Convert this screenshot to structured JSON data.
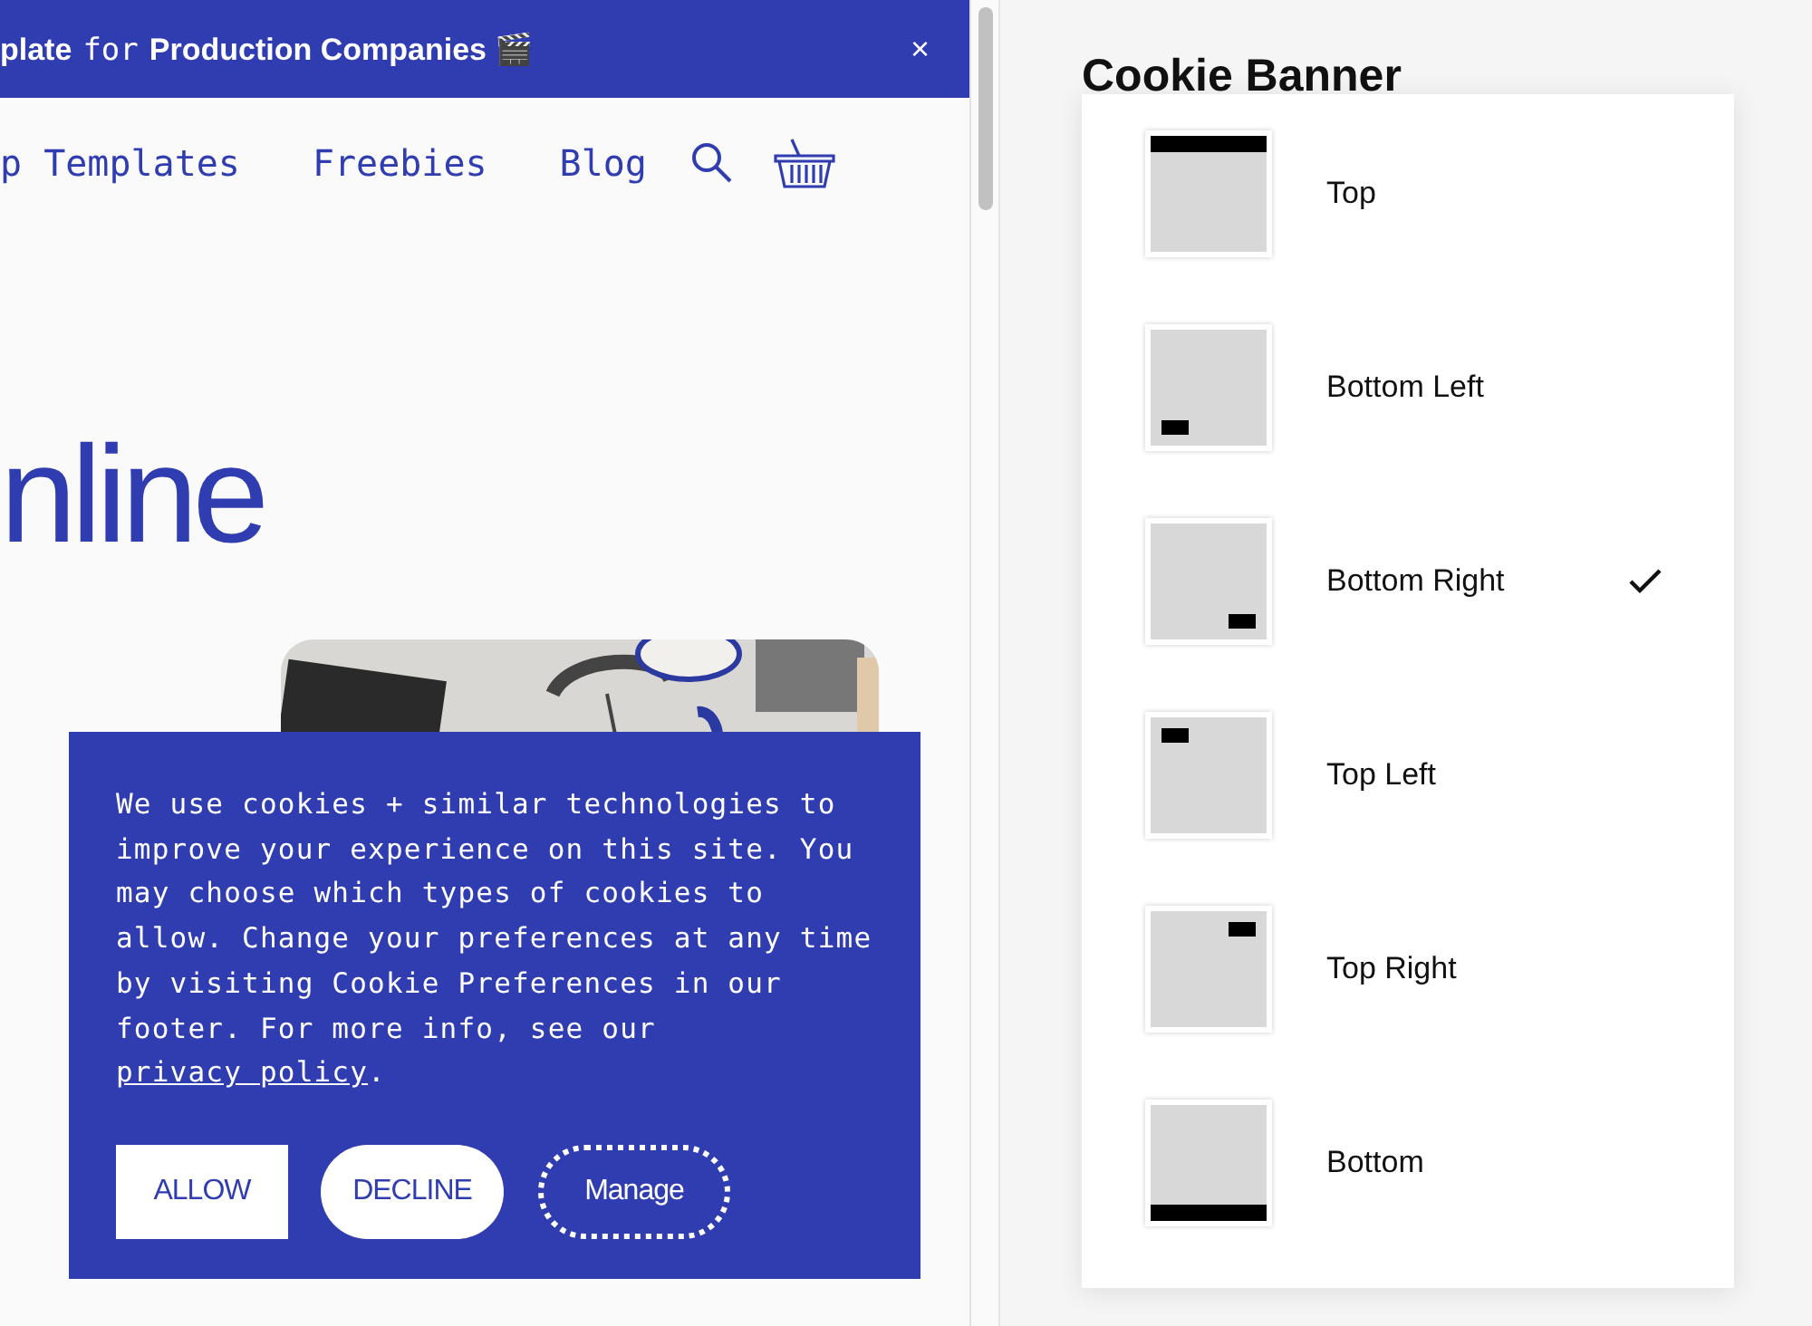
{
  "announcement": {
    "segments": [
      {
        "kind": "sans",
        "text": "plate"
      },
      {
        "kind": "mono",
        "text": "for"
      },
      {
        "kind": "sans",
        "text": "Production Companies 🎬"
      }
    ],
    "close": "×"
  },
  "nav": {
    "items": [
      "p Templates",
      "Freebies",
      "Blog"
    ]
  },
  "headline": "nline",
  "cookie_banner": {
    "message": "We use cookies + similar technologies to improve your experience on this site. You may choose which types of cookies to allow. Change your preferences at any time by visiting Cookie Preferences in our footer. For more info, see our ",
    "link": "privacy policy",
    "end": ".",
    "buttons": [
      {
        "kind": "square",
        "label": "ALLOW"
      },
      {
        "kind": "pill",
        "label": "DECLINE"
      },
      {
        "kind": "dotted",
        "label": "Manage"
      }
    ]
  },
  "panel": {
    "title": "Cookie Banner"
  },
  "position_menu": {
    "options": [
      {
        "kind": "top",
        "label": "Top",
        "selected": false
      },
      {
        "kind": "bottom-left",
        "label": "Bottom Left",
        "selected": false
      },
      {
        "kind": "bottom-right",
        "label": "Bottom Right",
        "selected": true
      },
      {
        "kind": "top-left",
        "label": "Top Left",
        "selected": false
      },
      {
        "kind": "top-right",
        "label": "Top Right",
        "selected": false
      },
      {
        "kind": "bottom",
        "label": "Bottom",
        "selected": false
      }
    ]
  }
}
